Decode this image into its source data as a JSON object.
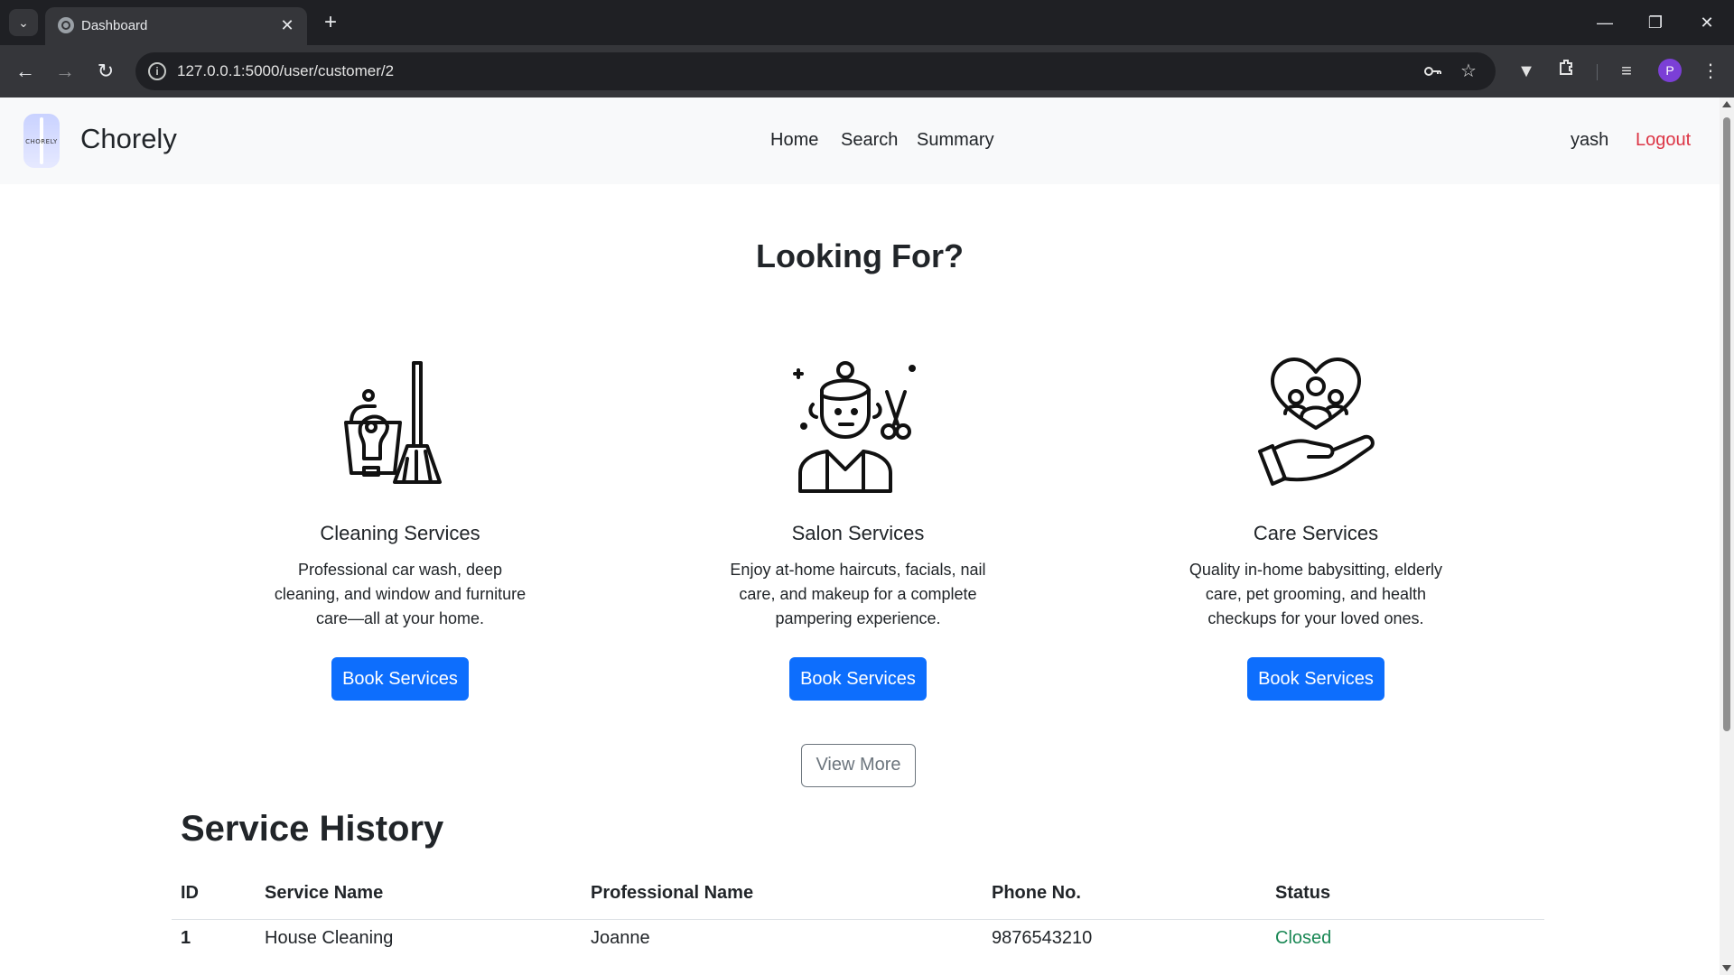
{
  "browser": {
    "tab_title": "Dashboard",
    "url": "127.0.0.1:5000/user/customer/2",
    "profile_initial": "P"
  },
  "navbar": {
    "logo_text": "CHORELY",
    "brand": "Chorely",
    "links": [
      "Home",
      "Search",
      "Summary"
    ],
    "user": "yash",
    "logout": "Logout"
  },
  "main": {
    "heading": "Looking For?",
    "cards": [
      {
        "title": "Cleaning Services",
        "text": "Professional car wash, deep cleaning, and window and furniture care—all at your home.",
        "button": "Book Services",
        "icon": "cleaning-icon"
      },
      {
        "title": "Salon Services",
        "text": "Enjoy at-home haircuts, facials, nail care, and makeup for a complete pampering experience.",
        "button": "Book Services",
        "icon": "salon-icon"
      },
      {
        "title": "Care Services",
        "text": "Quality in-home babysitting, elderly care, pet grooming, and health checkups for your loved ones.",
        "button": "Book Services",
        "icon": "care-icon"
      }
    ],
    "view_more": "View More"
  },
  "history": {
    "title": "Service History",
    "columns": [
      "ID",
      "Service Name",
      "Professional Name",
      "Phone No.",
      "Status"
    ],
    "rows": [
      {
        "id": "1",
        "service": "House Cleaning",
        "professional": "Joanne",
        "phone": "9876543210",
        "status": "Closed"
      }
    ]
  },
  "colors": {
    "primary": "#0d6efd",
    "danger": "#dc3545",
    "success": "#198754",
    "navbar_bg": "#f8f9fa"
  }
}
